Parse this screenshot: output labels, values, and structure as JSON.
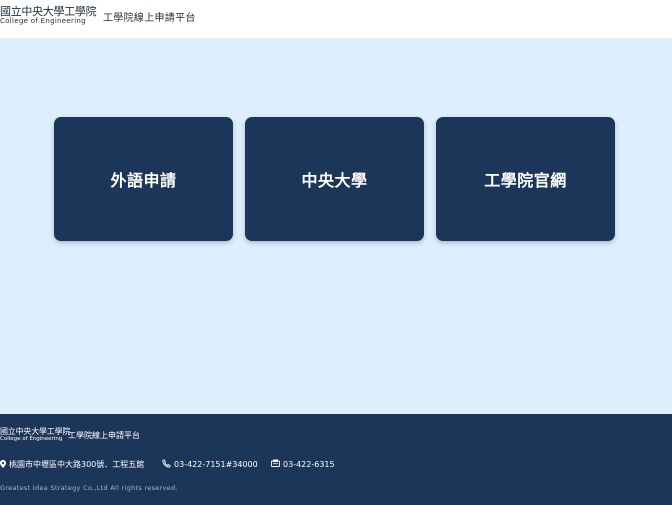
{
  "header": {
    "logo_cn": "國立中央大學工學院",
    "logo_en": "College of Engineering",
    "site_title": "工學院線上申請平台"
  },
  "cards": [
    {
      "label": "外語申請"
    },
    {
      "label": "中央大學"
    },
    {
      "label": "工學院官網"
    }
  ],
  "footer": {
    "logo_cn": "國立中央大學工學院",
    "logo_en": "College of Engineering",
    "site_title": "工學院線上申請平台",
    "address": "桃園市中壢區中大路300號．工程五館",
    "tel": "03-422-7151#34000",
    "fax": "03-422-6315",
    "copyright": "Greatest Idea Strategy Co.,Ltd All rights reserved."
  },
  "colors": {
    "main_bg": "#ddeefd",
    "card_bg": "#1c3659",
    "footer_bg": "#1c3659"
  },
  "icons": {
    "address": "map-pin-icon",
    "tel": "phone-icon",
    "fax": "fax-icon"
  }
}
